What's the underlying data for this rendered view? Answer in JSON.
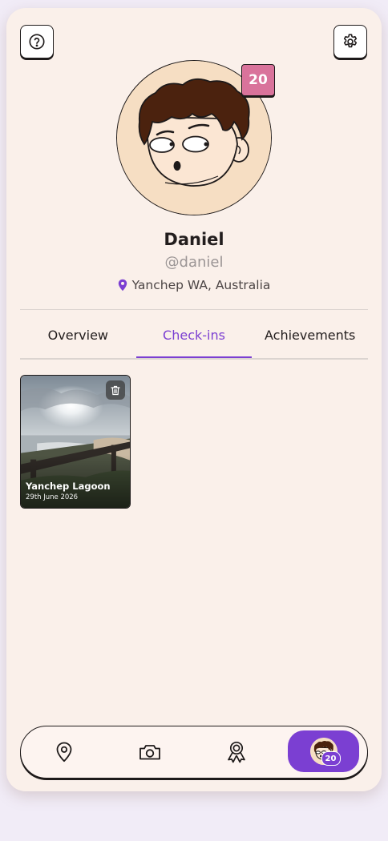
{
  "header": {
    "help_icon": "question-circle-icon",
    "settings_icon": "gear-icon"
  },
  "profile": {
    "level": "20",
    "name": "Daniel",
    "handle": "@daniel",
    "location_icon": "map-pin-icon",
    "location": "Yanchep WA, Australia"
  },
  "tabs": [
    {
      "label": "Overview"
    },
    {
      "label": "Check-ins"
    },
    {
      "label": "Achievements"
    }
  ],
  "active_tab": "Check-ins",
  "checkins": [
    {
      "title": "Yanchep Lagoon",
      "date": "29th June 2026"
    }
  ],
  "nav": {
    "items": [
      {
        "icon": "map-pin-icon"
      },
      {
        "icon": "camera-icon"
      },
      {
        "icon": "award-ribbon-icon"
      },
      {
        "icon": "profile-avatar-icon",
        "badge": "20"
      }
    ]
  },
  "colors": {
    "accent": "#7b3fd2",
    "badge": "#d9739b",
    "background": "#faf0ea"
  }
}
